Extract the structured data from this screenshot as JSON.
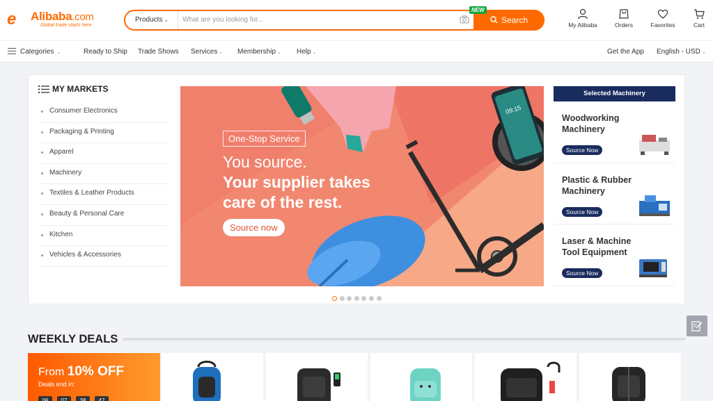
{
  "header": {
    "logo_mark": "e",
    "logo_name": "Alibaba",
    "logo_suffix": ".com",
    "logo_tagline": "Global trade starts here.",
    "search_category": "Products",
    "search_placeholder": "What are you looking for...",
    "new_badge": "NEW",
    "search_button": "Search",
    "icons": [
      {
        "label": "My Alibaba",
        "icon": "user-icon"
      },
      {
        "label": "Orders",
        "icon": "orders-icon"
      },
      {
        "label": "Favorites",
        "icon": "heart-icon"
      },
      {
        "label": "Cart",
        "icon": "cart-icon"
      }
    ]
  },
  "nav": {
    "categories": "Categories",
    "ready_to_ship": "Ready to Ship",
    "trade_shows": "Trade Shows",
    "services": "Services",
    "membership": "Membership",
    "help": "Help",
    "get_app": "Get the App",
    "language": "English - USD"
  },
  "markets": {
    "title": "MY MARKETS",
    "items": [
      "Consumer Electronics",
      "Packaging & Printing",
      "Apparel",
      "Machinery",
      "Textiles & Leather Products",
      "Beauty & Personal Care",
      "Kitchen",
      "Vehicles & Accessories"
    ]
  },
  "banner": {
    "pill": "One-Stop Service",
    "line1": "You source.",
    "line2": "Your supplier takes",
    "line3": "care of the rest.",
    "cta": "Source now",
    "slide_count": 7,
    "active_slide": 1
  },
  "selected": {
    "title": "Selected Machinery",
    "cards": [
      {
        "name": "Woodworking Machinery",
        "button": "Source Now"
      },
      {
        "name": "Plastic & Rubber Machinery",
        "button": "Source Now"
      },
      {
        "name": "Laser & Machine Tool Equipment",
        "button": "Source Now"
      }
    ]
  },
  "deals": {
    "title": "WEEKLY DEALS",
    "promo_prefix": "From ",
    "promo_value": "10% OFF",
    "promo_sub": "Deals end in:",
    "countdown": [
      "06",
      "07",
      "38",
      "47"
    ]
  },
  "colors": {
    "accent": "#ff6a00",
    "navy": "#1a2c5e",
    "banner_bg": "#f28770"
  }
}
